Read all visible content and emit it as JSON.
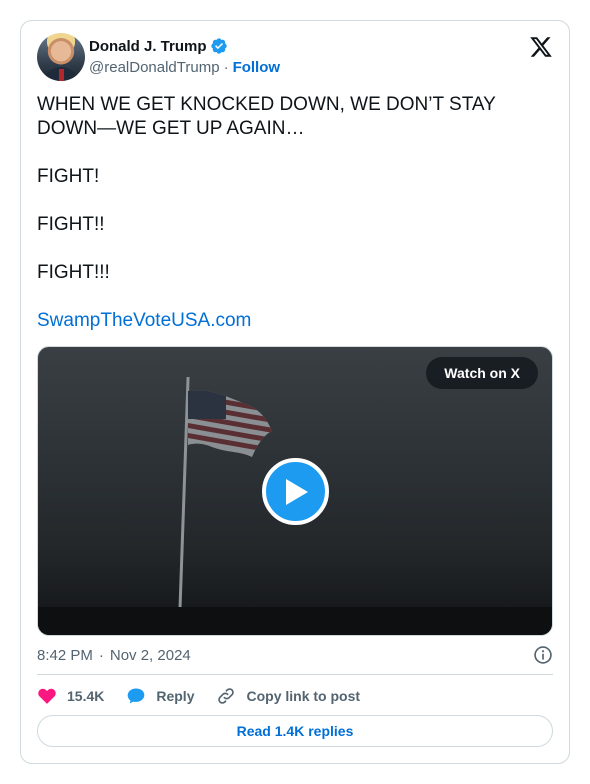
{
  "author": {
    "display_name": "Donald J. Trump",
    "handle": "@realDonaldTrump",
    "separator": "·",
    "follow_label": "Follow",
    "verified_color": "#1d9bf0"
  },
  "tweet": {
    "line1": "WHEN WE GET KNOCKED DOWN, WE DON’T STAY",
    "line2": "DOWN—WE GET UP AGAIN…",
    "line3": "FIGHT!",
    "line4": "FIGHT!!",
    "line5": "FIGHT!!!",
    "link": "SwampTheVoteUSA.com"
  },
  "media": {
    "watch_label": "Watch on X",
    "play_icon": "play-icon"
  },
  "meta": {
    "time": "8:42 PM",
    "separator": "·",
    "date": "Nov 2, 2024"
  },
  "actions": {
    "likes": "15.4K",
    "reply_label": "Reply",
    "copy_label": "Copy link to post",
    "like_color": "#f91880",
    "accent": "#1d9bf0"
  },
  "replies_button": "Read 1.4K replies"
}
